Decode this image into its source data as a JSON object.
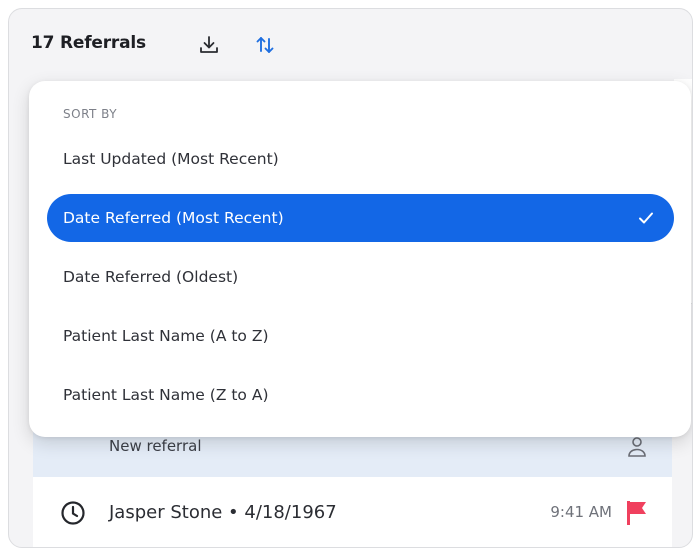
{
  "header": {
    "title": "17 Referrals",
    "download_icon": "download-icon",
    "sort_icon": "sort-arrows-icon"
  },
  "sort_menu": {
    "heading": "SORT BY",
    "options": [
      {
        "label": "Last Updated (Most Recent)",
        "selected": false
      },
      {
        "label": "Date Referred (Most Recent)",
        "selected": true
      },
      {
        "label": "Date Referred (Oldest)",
        "selected": false
      },
      {
        "label": "Patient Last Name (A to Z)",
        "selected": false
      },
      {
        "label": "Patient Last Name (Z to A)",
        "selected": false
      }
    ],
    "check_icon": "check-icon"
  },
  "list": {
    "new_referral_label": "New referral",
    "new_referral_icon": "person-icon",
    "patient": {
      "name_dob": "Jasper Stone • 4/18/1967",
      "time": "9:41 AM",
      "status_icon": "clock-icon",
      "flag_icon": "flag-icon"
    }
  },
  "colors": {
    "accent": "#1367e6",
    "sort_icon": "#1f6fe0",
    "flag": "#f0405e",
    "selected_row_bg": "#e4ecf7",
    "panel_bg": "#f4f4f6"
  }
}
